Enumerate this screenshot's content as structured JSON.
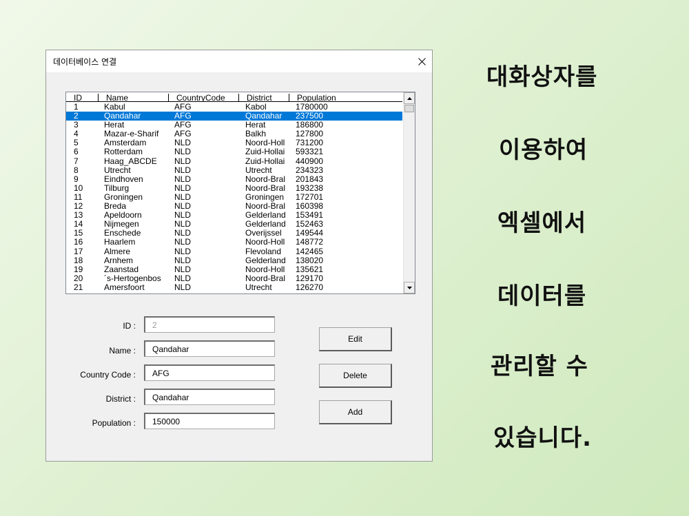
{
  "dialog": {
    "title": "데이터베이스 연결",
    "close_glyph": "close-icon"
  },
  "listview": {
    "columns": [
      "ID",
      "Name",
      "CountryCode",
      "District",
      "Population"
    ],
    "selected_index": 1,
    "rows": [
      [
        "1",
        "Kabul",
        "AFG",
        "Kabol",
        "1780000"
      ],
      [
        "2",
        "Qandahar",
        "AFG",
        "Qandahar",
        "237500"
      ],
      [
        "3",
        "Herat",
        "AFG",
        "Herat",
        "186800"
      ],
      [
        "4",
        "Mazar-e-Sharif",
        "AFG",
        "Balkh",
        "127800"
      ],
      [
        "5",
        "Amsterdam",
        "NLD",
        "Noord-Holl",
        "731200"
      ],
      [
        "6",
        "Rotterdam",
        "NLD",
        "Zuid-Hollai",
        "593321"
      ],
      [
        "7",
        "Haag_ABCDE",
        "NLD",
        "Zuid-Hollai",
        "440900"
      ],
      [
        "8",
        "Utrecht",
        "NLD",
        "Utrecht",
        "234323"
      ],
      [
        "9",
        "Eindhoven",
        "NLD",
        "Noord-Bral",
        "201843"
      ],
      [
        "10",
        "Tilburg",
        "NLD",
        "Noord-Bral",
        "193238"
      ],
      [
        "11",
        "Groningen",
        "NLD",
        "Groningen",
        "172701"
      ],
      [
        "12",
        "Breda",
        "NLD",
        "Noord-Bral",
        "160398"
      ],
      [
        "13",
        "Apeldoorn",
        "NLD",
        "Gelderland",
        "153491"
      ],
      [
        "14",
        "Nijmegen",
        "NLD",
        "Gelderland",
        "152463"
      ],
      [
        "15",
        "Enschede",
        "NLD",
        "Overijssel",
        "149544"
      ],
      [
        "16",
        "Haarlem",
        "NLD",
        "Noord-Holl",
        "148772"
      ],
      [
        "17",
        "Almere",
        "NLD",
        "Flevoland",
        "142465"
      ],
      [
        "18",
        "Arnhem",
        "NLD",
        "Gelderland",
        "138020"
      ],
      [
        "19",
        "Zaanstad",
        "NLD",
        "Noord-Holl",
        "135621"
      ],
      [
        "20",
        "´s-Hertogenbos",
        "NLD",
        "Noord-Bral",
        "129170"
      ],
      [
        "21",
        "Amersfoort",
        "NLD",
        "Utrecht",
        "126270"
      ]
    ]
  },
  "form": {
    "id_label": "ID :",
    "id_value": "2",
    "name_label": "Name :",
    "name_value": "Qandahar",
    "country_label": "Country Code :",
    "country_value": "AFG",
    "district_label": "District :",
    "district_value": "Qandahar",
    "population_label": "Population :",
    "population_value": "150000"
  },
  "buttons": {
    "edit": "Edit",
    "delete": "Delete",
    "add": "Add"
  },
  "caption": {
    "lines": [
      "대화상자를",
      "이용하여",
      "엑셀에서",
      "데이터를",
      "관리할 수",
      "있습니다."
    ]
  },
  "colors": {
    "selection": "#0078d7",
    "background": "#dff0d2"
  }
}
